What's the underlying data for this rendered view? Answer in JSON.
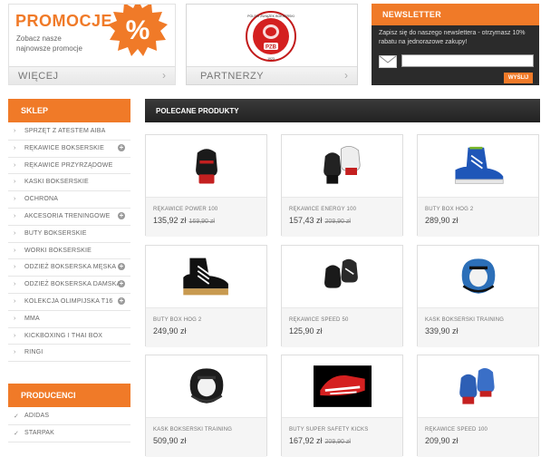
{
  "promo": {
    "title": "PROMOCJE",
    "description": "Zobacz nasze najnowsze promocje",
    "badge": "%",
    "more_label": "WIĘCEJ"
  },
  "partners": {
    "logo_text": "PZB",
    "logo_ring_text": "POLSKI ZWIĄZEK BOKSERSKI",
    "logo_year": "1923",
    "label": "PARTNERZY"
  },
  "newsletter": {
    "title": "NEWSLETTER",
    "text": "Zapisz się do naszego newslettera - otrzymasz 10% rabatu na jednorazowe zakupy!",
    "input_value": "",
    "send_label": "WYŚLIJ"
  },
  "shop": {
    "title": "SKLEP",
    "items": [
      {
        "label": "SPRZĘT Z ATESTEM AIBA",
        "expandable": false
      },
      {
        "label": "RĘKAWICE BOKSERSKIE",
        "expandable": true
      },
      {
        "label": "RĘKAWICE PRZYRZĄDOWE",
        "expandable": false
      },
      {
        "label": "KASKI BOKSERSKIE",
        "expandable": false
      },
      {
        "label": "OCHRONA",
        "expandable": false
      },
      {
        "label": "AKCESORIA TRENINGOWE",
        "expandable": true
      },
      {
        "label": "BUTY BOKSERSKIE",
        "expandable": false
      },
      {
        "label": "WORKI BOKSERSKIE",
        "expandable": false
      },
      {
        "label": "ODZIEŻ BOKSERSKA MĘSKA",
        "expandable": true
      },
      {
        "label": "ODZIEŻ BOKSERSKA DAMSKA",
        "expandable": true
      },
      {
        "label": "KOLEKCJA OLIMPIJSKA T16",
        "expandable": true
      },
      {
        "label": "MMA",
        "expandable": false
      },
      {
        "label": "KICKBOXING I THAI BOX",
        "expandable": false
      },
      {
        "label": "RINGI",
        "expandable": false
      }
    ]
  },
  "producers": {
    "title": "PRODUCENCI",
    "items": [
      {
        "label": "ADIDAS"
      },
      {
        "label": "STARPAK"
      }
    ]
  },
  "featured": {
    "title": "POLECANE PRODUKTY",
    "products": [
      {
        "name": "RĘKAWICE POWER 100",
        "price": "135,92 zł",
        "old_price": "169,90 zł",
        "image": "boxing-gloves-black-red-icon"
      },
      {
        "name": "RĘKAWICE ENERGY 100",
        "price": "157,43 zł",
        "old_price": "209,90 zł",
        "image": "boxing-gloves-black-white-icon"
      },
      {
        "name": "BUTY BOX HOG 2",
        "price": "289,90 zł",
        "old_price": "",
        "image": "boxing-shoe-blue-icon"
      },
      {
        "name": "BUTY BOX HOG 2",
        "price": "249,90 zł",
        "old_price": "",
        "image": "boxing-shoe-black-icon"
      },
      {
        "name": "RĘKAWICE SPEED 50",
        "price": "125,90 zł",
        "old_price": "",
        "image": "boxing-gloves-black-pair-icon"
      },
      {
        "name": "KASK BOKSERSKI TRAINING",
        "price": "339,90 zł",
        "old_price": "",
        "image": "headguard-blue-icon"
      },
      {
        "name": "KASK BOKSERSKI TRAINING",
        "price": "509,90 zł",
        "old_price": "",
        "image": "headguard-black-icon"
      },
      {
        "name": "BUTY SUPER SAFETY KICKS",
        "price": "167,92 zł",
        "old_price": "209,90 zł",
        "image": "foot-protector-icon"
      },
      {
        "name": "RĘKAWICE SPEED 100",
        "price": "209,90 zł",
        "old_price": "",
        "image": "boxing-gloves-blue-icon"
      }
    ]
  },
  "colors": {
    "accent": "#f07a28",
    "dark": "#2b2b2b"
  }
}
